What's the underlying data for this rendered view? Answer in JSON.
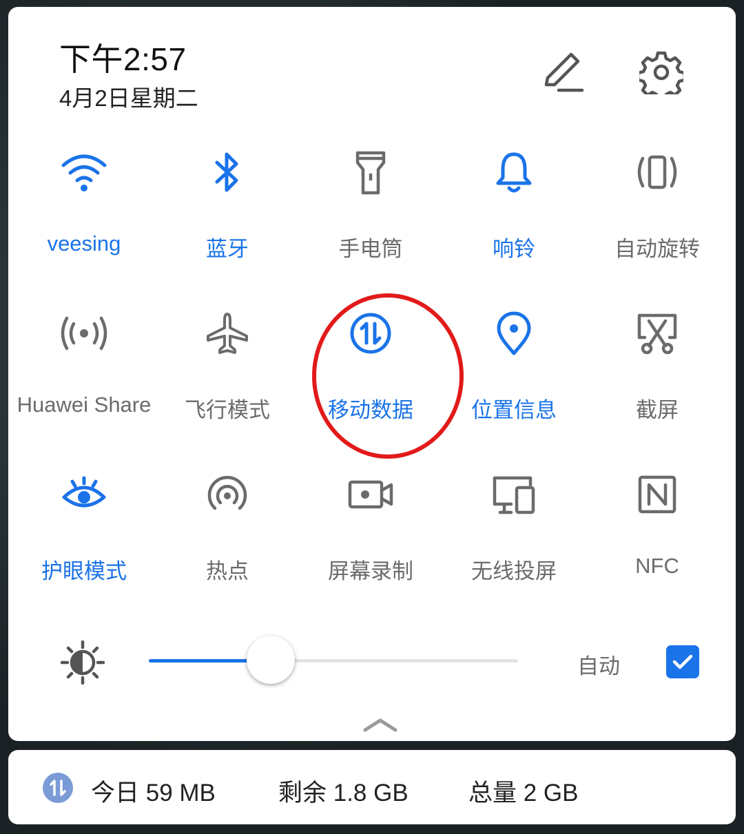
{
  "header": {
    "time": "下午2:57",
    "date": "4月2日星期二"
  },
  "tiles": [
    {
      "label": "veesing",
      "icon": "wifi-icon",
      "active": true
    },
    {
      "label": "蓝牙",
      "icon": "bluetooth-icon",
      "active": true
    },
    {
      "label": "手电筒",
      "icon": "flashlight-icon",
      "active": false
    },
    {
      "label": "响铃",
      "icon": "bell-icon",
      "active": true
    },
    {
      "label": "自动旋转",
      "icon": "auto-rotate-icon",
      "active": false
    },
    {
      "label": "Huawei Share",
      "icon": "huawei-share-icon",
      "active": false
    },
    {
      "label": "飞行模式",
      "icon": "airplane-icon",
      "active": false
    },
    {
      "label": "移动数据",
      "icon": "mobile-data-icon",
      "active": true
    },
    {
      "label": "位置信息",
      "icon": "location-icon",
      "active": true
    },
    {
      "label": "截屏",
      "icon": "screenshot-icon",
      "active": false
    },
    {
      "label": "护眼模式",
      "icon": "eye-comfort-icon",
      "active": true
    },
    {
      "label": "热点",
      "icon": "hotspot-icon",
      "active": false
    },
    {
      "label": "屏幕录制",
      "icon": "screen-record-icon",
      "active": false
    },
    {
      "label": "无线投屏",
      "icon": "wireless-projection-icon",
      "active": false
    },
    {
      "label": "NFC",
      "icon": "nfc-icon",
      "active": false
    }
  ],
  "brightness": {
    "level": 0.33,
    "auto_label": "自动",
    "auto_checked": true
  },
  "data_usage": {
    "today": "今日 59 MB",
    "remaining": "剩余 1.8 GB",
    "total": "总量 2 GB"
  },
  "colors": {
    "accent": "#1a73e8",
    "inactive": "#6b6b6b",
    "highlight": "#e21a1a"
  }
}
